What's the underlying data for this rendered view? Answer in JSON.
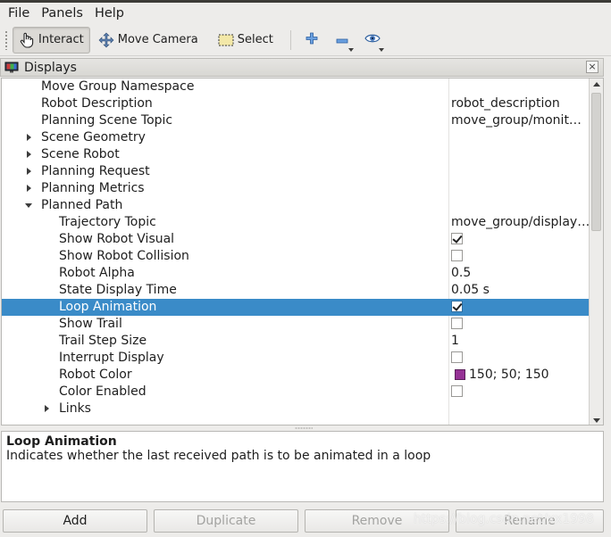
{
  "menu": {
    "file": "File",
    "panels": "Panels",
    "help": "Help"
  },
  "toolbar": {
    "interact": "Interact",
    "move_camera": "Move Camera",
    "select": "Select"
  },
  "panel": {
    "title": "Displays"
  },
  "tree": {
    "rows": [
      {
        "name": "Move Group Namespace",
        "value": ""
      },
      {
        "name": "Robot Description",
        "value": "robot_description"
      },
      {
        "name": "Planning Scene Topic",
        "value": "move_group/monit…"
      },
      {
        "name": "Scene Geometry",
        "value": ""
      },
      {
        "name": "Scene Robot",
        "value": ""
      },
      {
        "name": "Planning Request",
        "value": ""
      },
      {
        "name": "Planning Metrics",
        "value": ""
      },
      {
        "name": "Planned Path",
        "value": ""
      },
      {
        "name": "Trajectory Topic",
        "value": "move_group/display…"
      },
      {
        "name": "Show Robot Visual",
        "value": "",
        "checked": true
      },
      {
        "name": "Show Robot Collision",
        "value": "",
        "checked": false
      },
      {
        "name": "Robot Alpha",
        "value": "0.5"
      },
      {
        "name": "State Display Time",
        "value": "0.05 s"
      },
      {
        "name": "Loop Animation",
        "value": "",
        "checked": true,
        "selected": true
      },
      {
        "name": "Show Trail",
        "value": "",
        "checked": false
      },
      {
        "name": "Trail Step Size",
        "value": "1"
      },
      {
        "name": "Interrupt Display",
        "value": "",
        "checked": false
      },
      {
        "name": "Robot Color",
        "value": "150; 50; 150",
        "color": "#963296"
      },
      {
        "name": "Color Enabled",
        "value": "",
        "checked": false
      },
      {
        "name": "Links",
        "value": ""
      }
    ]
  },
  "help": {
    "title": "Loop Animation",
    "description": "Indicates whether the last received path is to be animated in a loop"
  },
  "buttons": {
    "add": "Add",
    "duplicate": "Duplicate",
    "remove": "Remove",
    "rename": "Rename"
  },
  "watermark": "https://blog.csdn.net/xx1998",
  "colors": {
    "selection": "#3a8bc8",
    "robot_color": "#963296"
  }
}
